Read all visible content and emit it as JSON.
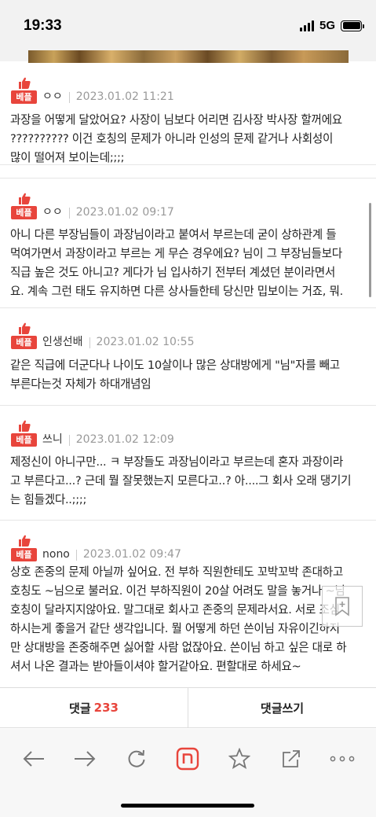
{
  "status": {
    "time": "19:33",
    "network": "5G"
  },
  "comments": [
    {
      "badge": "베플",
      "author": "ㅇㅇ",
      "date": "2023.01.02 11:21",
      "lines": [
        "과장을 어떻게 달았어요? 사장이 님보다 어리면 김사장 박사장 할꺼에요",
        "?????????? 이건 호칭의 문제가 아니라 인성의 문제 같거나 사회성이",
        "많이 떨어져 보이는데;;;;"
      ]
    },
    {
      "badge": "베플",
      "author": "ㅇㅇ",
      "date": "2023.01.02 09:17",
      "lines": [
        "아니 다른 부장님들이 과장님이라고 붙여서 부르는데 굳이 상하관계 들",
        "먹여가면서 과장이라고 부르는 게 무슨 경우에요? 님이 그 부장님들보다",
        "직급 높은 것도 아니고? 게다가 님 입사하기 전부터 계셨던 분이라면서",
        "요. 계속 그런 태도 유지하면 다른 상사들한테 당신만 밉보이는 거죠, 뭐."
      ]
    },
    {
      "badge": "베플",
      "author": "인생선배",
      "date": "2023.01.02 10:55",
      "lines": [
        "같은 직급에 더군다나 나이도 10살이나 많은 상대방에게 \"님\"자를 빼고",
        "부른다는것 자체가 하대개념임"
      ]
    },
    {
      "badge": "베플",
      "author": "쓰니",
      "date": "2023.01.02 12:09",
      "lines": [
        "제정신이 아니구만... ㅋ 부장들도 과장님이라고 부르는데 혼자 과장이라",
        "고 부른다고...? 근데 뭘 잘못했는지 모른다고..? 아....그 회사 오래 댕기기",
        "는 힘들겠다..;;;;"
      ]
    },
    {
      "badge": "베플",
      "author": "nono",
      "date": "2023.01.02 09:47",
      "lines": [
        "상호 존중의 문제 아닐까 싶어요. 전 부하 직원한테도 꼬박꼬박 존대하고",
        "호칭도 ~님으로 불러요. 이건 부하직원이 20살 어려도 말을 놓거나 ~님",
        "호칭이 달라지지않아요. 말그대로 회사고 존중의 문제라서요. 서로 조심",
        "하시는게 좋을거 같단 생각입니다. 뭘 어떻게 하던 쓴이님 자유이긴하지",
        "만 상대방을 존중해주면 싫어할 사람 없잖아요. 쓴이님 하고 싶은 대로 하",
        "셔서 나온 결과는 받아들이셔야 할거같아요. 편할대로 하세요~"
      ]
    }
  ],
  "tabs": {
    "comments_label": "댓글",
    "comments_count": "233",
    "write_label": "댓글쓰기"
  },
  "colors": {
    "accent": "#e8453c"
  }
}
